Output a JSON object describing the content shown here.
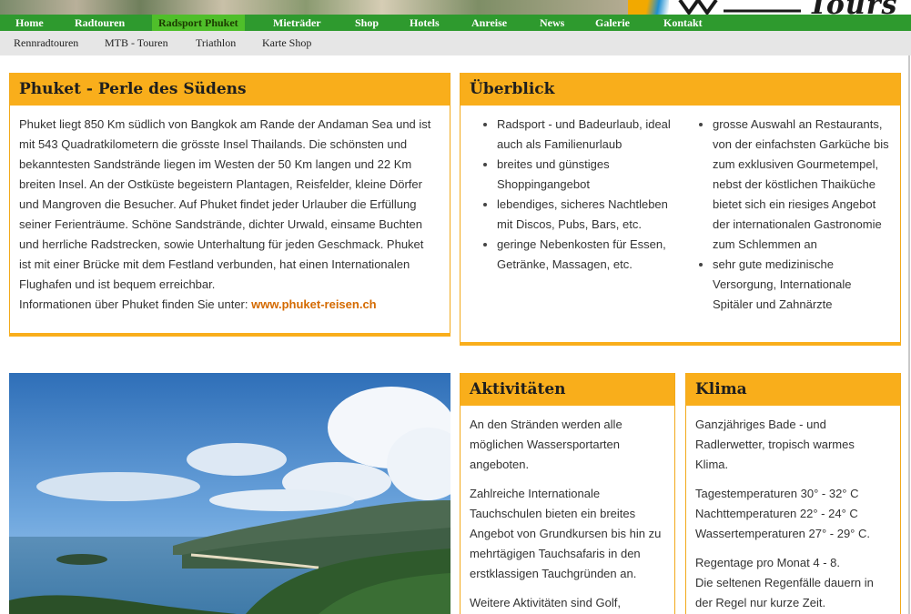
{
  "brand": {
    "logo_text": "Tours"
  },
  "main_nav": {
    "items": [
      {
        "label": "Home"
      },
      {
        "label": "Radtouren"
      },
      {
        "label": "Radsport Phuket"
      },
      {
        "label": "Mieträder"
      },
      {
        "label": "Shop"
      },
      {
        "label": "Hotels"
      },
      {
        "label": "Anreise"
      },
      {
        "label": "News"
      },
      {
        "label": "Galerie"
      },
      {
        "label": "Kontakt"
      }
    ],
    "active": "Radsport Phuket"
  },
  "sub_nav": {
    "items": [
      {
        "label": "Rennradtouren"
      },
      {
        "label": "MTB - Touren"
      },
      {
        "label": "Triathlon"
      },
      {
        "label": "Karte Shop"
      }
    ]
  },
  "intro": {
    "title": "Phuket - Perle des Südens",
    "lines": [
      "Phuket liegt 850 Km südlich von Bangkok am Rande der Andaman Sea und ist",
      "mit 543 Quadratkilometern die grösste Insel Thailands. Die schönsten und",
      "bekanntesten Sandstrände liegen im Westen der 50 Km langen und 22 Km",
      "breiten Insel. An der Ostküste begeistern Plantagen, Reisfelder, kleine Dörfer",
      "und Mangroven die Besucher. Auf Phuket findet jeder Urlauber die Erfüllung",
      "seiner Ferienträume. Schöne Sandstrände, dichter Urwald, einsame Buchten",
      "und herrliche Radstrecken, sowie Unterhaltung für jeden Geschmack. Phuket",
      "ist mit einer Brücke mit dem Festland verbunden, hat einen Internationalen",
      "Flughafen und ist bequem erreichbar."
    ],
    "info_label": "Informationen über Phuket finden Sie unter:",
    "info_link": "www.phuket-reisen.ch"
  },
  "overview": {
    "title": "Überblick",
    "col1": [
      [
        "Radsport - und Badeurlaub, ideal",
        "auch als Familienurlaub"
      ],
      [
        "breites und günstiges",
        "Shoppingangebot"
      ],
      [
        "lebendiges, sicheres Nachtleben",
        "mit Discos, Pubs, Bars, etc."
      ],
      [
        "geringe Nebenkosten für Essen,",
        "Getränke, Massagen, etc."
      ]
    ],
    "col2": [
      [
        "grosse Auswahl an Restaurants,",
        "von der einfachsten Garküche bis",
        "zum exklusiven Gourmetempel,",
        "nebst der köstlichen Thaiküche",
        "bietet sich ein riesiges Angebot",
        "der internationalen Gastronomie",
        "zum Schlemmen an"
      ],
      [
        "sehr gute medizinische",
        "Versorgung, Internationale",
        "Spitäler und Zahnärzte"
      ]
    ]
  },
  "activities": {
    "title": "Aktivitäten",
    "paragraphs": [
      [
        "An den Stränden werden alle",
        "möglichen Wassersportarten",
        "angeboten."
      ],
      [
        "Zahlreiche Internationale",
        "Tauchschulen bieten ein breites",
        "Angebot von Grundkursen bis hin zu",
        "mehrtägigen Tauchsafaris in den",
        "erstklassigen Tauchgründen an."
      ],
      [
        "Weitere Aktivitäten sind Golf,"
      ]
    ]
  },
  "climate": {
    "title": "Klima",
    "paragraphs": [
      [
        "Ganzjähriges Bade - und",
        "Radlerwetter, tropisch warmes",
        "Klima."
      ],
      [
        "Tagestemperaturen 30° - 32° C",
        "Nachttemperaturen 22° - 24° C",
        "Wassertemperaturen 27° - 29° C."
      ],
      [
        "Regentage pro Monat 4 - 8.",
        "Die seltenen Regenfälle dauern in",
        "der Regel nur kurze Zeit."
      ]
    ]
  },
  "colors": {
    "nav_green": "#2e9a2e",
    "nav_active": "#4fbf2a",
    "box_orange": "#f9ae1b",
    "link_orange": "#d46a00"
  }
}
